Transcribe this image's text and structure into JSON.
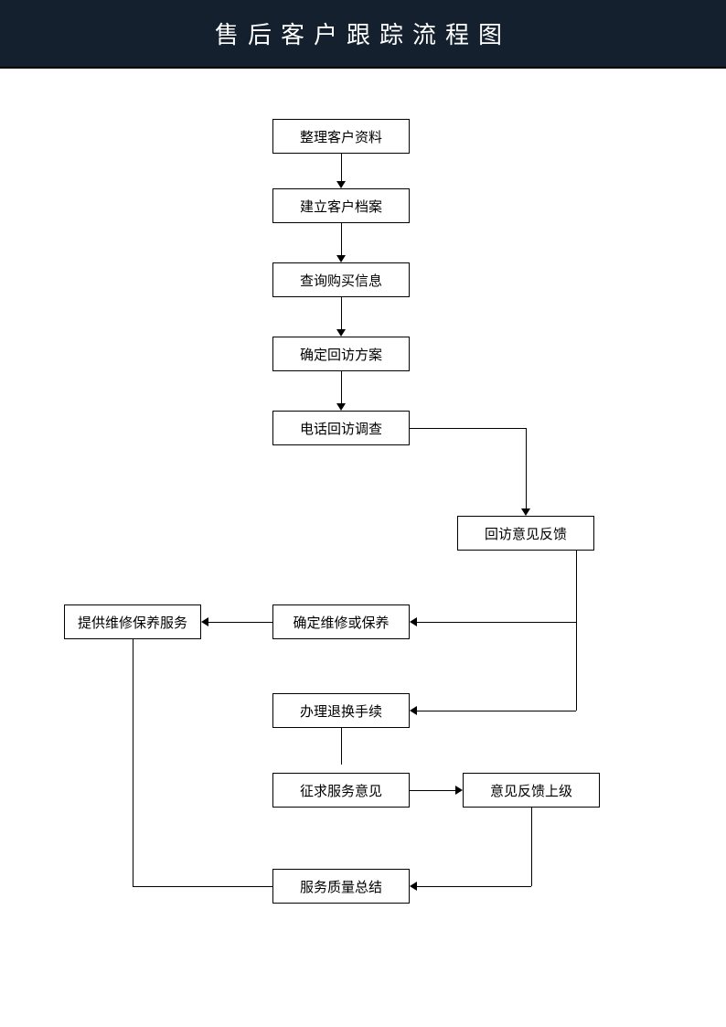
{
  "title": "售后客户跟踪流程图",
  "nodes": {
    "n1": "整理客户资料",
    "n2": "建立客户档案",
    "n3": "查询购买信息",
    "n4": "确定回访方案",
    "n5": "电话回访调查",
    "n6": "回访意见反馈",
    "n7": "提供维修保养服务",
    "n8": "确定维修或保养",
    "n9": "办理退换手续",
    "n10": "征求服务意见",
    "n11": "意见反馈上级",
    "n12": "服务质量总结"
  }
}
